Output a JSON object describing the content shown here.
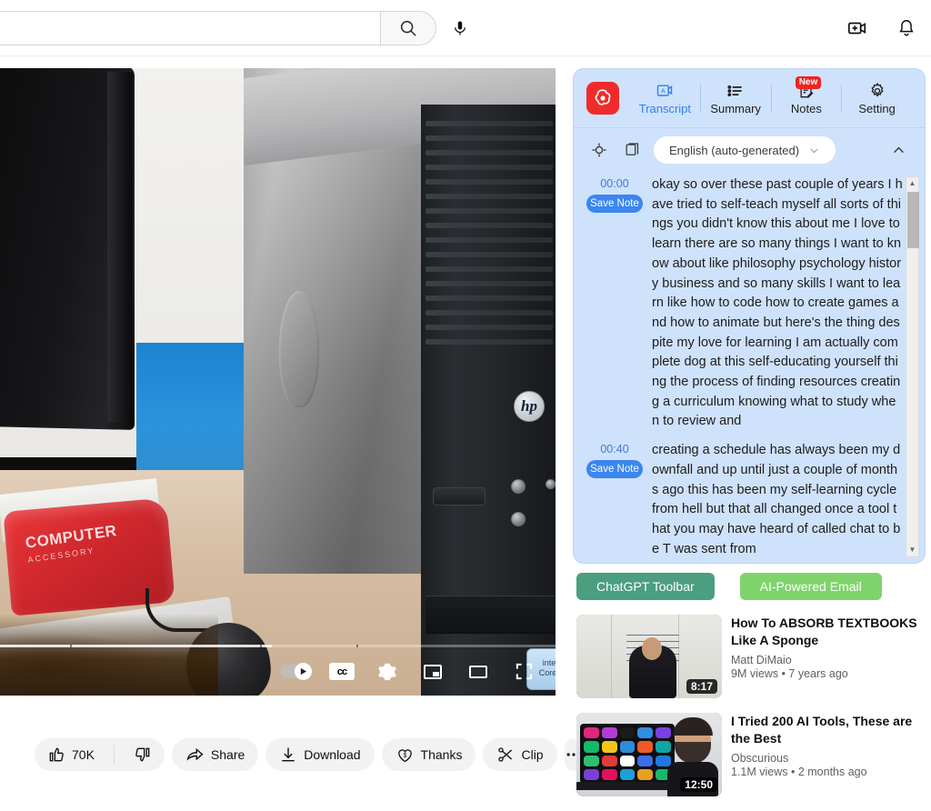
{
  "topbar": {
    "search": {
      "value": "",
      "placeholder": "",
      "icon": "search-icon"
    },
    "mic_icon": "microphone-icon",
    "create_icon": "create-video-icon",
    "notifications_icon": "bell-icon"
  },
  "player": {
    "progress_percent": 49,
    "controls": {
      "autoplay_label": "Autoplay",
      "captions_label": "CC",
      "settings_label": "Settings",
      "miniplayer_label": "Miniplayer",
      "theater_label": "Theater mode",
      "fullscreen_label": "Full screen"
    }
  },
  "actions": [
    {
      "name": "like",
      "icon": "thumbs-up-icon",
      "label": "70K"
    },
    {
      "name": "dislike",
      "icon": "thumbs-down-icon",
      "label": ""
    },
    {
      "name": "share",
      "icon": "share-icon",
      "label": "Share"
    },
    {
      "name": "download",
      "icon": "download-icon",
      "label": "Download"
    },
    {
      "name": "thanks",
      "icon": "thanks-heart-icon",
      "label": "Thanks"
    },
    {
      "name": "clip",
      "icon": "scissors-icon",
      "label": "Clip"
    },
    {
      "name": "more",
      "icon": "more-ellipsis-icon",
      "label": ""
    }
  ],
  "side_panel": {
    "brand_icon": "chatgpt-logo-icon",
    "tabs": [
      {
        "label": "Transcript",
        "icon": "transcript-icon",
        "active": true,
        "badge": ""
      },
      {
        "label": "Summary",
        "icon": "list-icon",
        "active": false,
        "badge": ""
      },
      {
        "label": "Notes",
        "icon": "note-pencil-icon",
        "active": false,
        "badge": "New"
      },
      {
        "label": "Setting",
        "icon": "gear-icon",
        "active": false,
        "badge": ""
      }
    ],
    "toolbar": {
      "target_icon": "target-crosshair-icon",
      "copy_icon": "copy-icon",
      "language": "English (auto-generated)",
      "language_caret": "chevron-down-icon",
      "collapse_icon": "chevron-up-icon"
    },
    "save_note_label": "Save Note",
    "transcript": [
      {
        "time": "00:00",
        "text": "okay so over these past couple of years I have tried to self-teach myself all sorts of things you didn't know this about me I love to learn there are so many things I want to know about like philosophy psychology history business and so many skills I want to learn like how to code how to create games and how to animate but here's the thing despite my love for learning I am actually complete dog at this self-educating yourself thing the process of finding resources creating a curriculum knowing what to study when to review and"
      },
      {
        "time": "00:40",
        "text": "creating a schedule has always been my downfall and up until just a couple of months ago this has been my self-learning cycle from hell but that all changed once a tool that you may have heard of called chat to be T was sent from"
      }
    ]
  },
  "promos": [
    {
      "label": "ChatGPT Toolbar",
      "color": "#4b9e80"
    },
    {
      "label": "AI-Powered Email",
      "color": "#7fd36b"
    }
  ],
  "suggested_videos": [
    {
      "title": "How To ABSORB TEXTBOOKS Like A Sponge",
      "channel": "Matt DiMaio",
      "meta": "9M views  •  7 years ago",
      "duration": "8:17"
    },
    {
      "title": "I Tried 200 AI Tools, These are the Best",
      "channel": "Obscurious",
      "meta": "1.1M views  •  2 months ago",
      "duration": "12:50"
    }
  ]
}
